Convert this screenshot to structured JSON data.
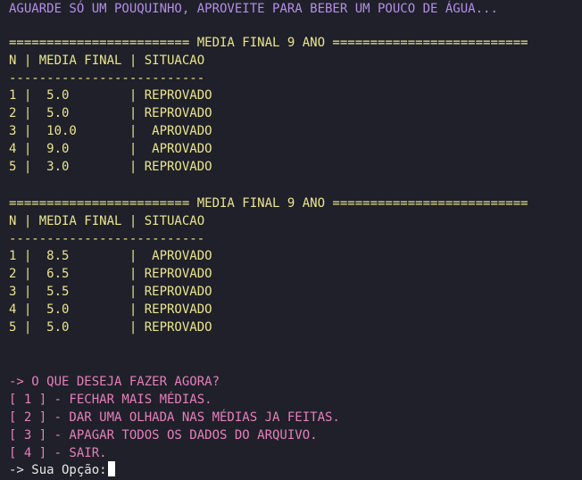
{
  "header_message": "AGUARDE SÓ UM POUQUINHO, APROVEITE PARA BEBER UM POUCO DE ÁGUA...",
  "tables": [
    {
      "title": "======================== MEDIA FINAL 9 ANO ==========================",
      "header": "N | MEDIA FINAL | SITUACAO",
      "separator": "--------------------------",
      "rows": [
        "1 |  5.0        | REPROVADO",
        "2 |  5.0        | REPROVADO",
        "3 |  10.0       |  APROVADO",
        "4 |  9.0        |  APROVADO",
        "5 |  3.0        | REPROVADO"
      ]
    },
    {
      "title": "======================== MEDIA FINAL 9 ANO ==========================",
      "header": "N | MEDIA FINAL | SITUACAO",
      "separator": "--------------------------",
      "rows": [
        "1 |  8.5        |  APROVADO",
        "2 |  6.5        | REPROVADO",
        "3 |  5.5        | REPROVADO",
        "4 |  5.0        | REPROVADO",
        "5 |  5.0        | REPROVADO"
      ]
    }
  ],
  "menu": {
    "question": "-> O QUE DESEJA FAZER AGORA?",
    "options": [
      "[ 1 ] - FECHAR MAIS MÉDIAS.",
      "[ 2 ] - DAR UMA OLHADA NAS MÉDIAS JA FEITAS.",
      "[ 3 ] - APAGAR TODOS OS DADOS DO ARQUIVO.",
      "[ 4 ] - SAIR."
    ]
  },
  "prompt": "-> Sua Opção:",
  "colors": {
    "background": "#1f2029",
    "header_text": "#b48ee8",
    "table_text": "#ebe58f",
    "menu_text": "#e77fbc",
    "prompt_text": "#e6e6e6",
    "cursor": "#ffffff"
  }
}
